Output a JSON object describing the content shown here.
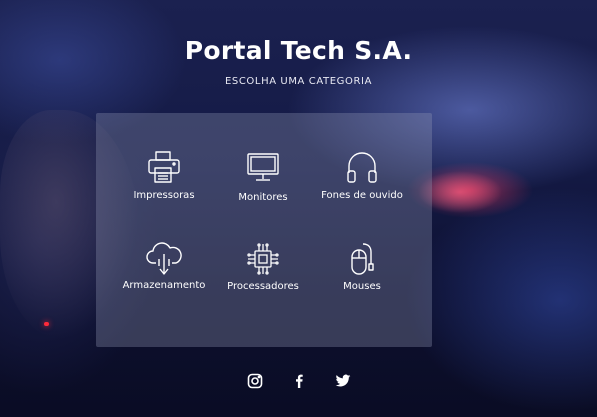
{
  "header": {
    "title": "Portal Tech S.A.",
    "subtitle": "ESCOLHA UMA CATEGORIA"
  },
  "categories": [
    {
      "label": "Impressoras",
      "icon": "printer-icon"
    },
    {
      "label": "Monitores",
      "icon": "monitor-icon"
    },
    {
      "label": "Fones de ouvido",
      "icon": "headphones-icon"
    },
    {
      "label": "Armazenamento",
      "icon": "cloud-storage-icon"
    },
    {
      "label": "Processadores",
      "icon": "cpu-chip-icon"
    },
    {
      "label": "Mouses",
      "icon": "mouse-icon"
    }
  ],
  "social": [
    {
      "icon": "instagram-icon"
    },
    {
      "icon": "facebook-icon"
    },
    {
      "icon": "twitter-icon"
    }
  ],
  "colors": {
    "text": "#ffffff",
    "panel": "rgba(150,155,185,0.32)",
    "background": "#141a45"
  }
}
